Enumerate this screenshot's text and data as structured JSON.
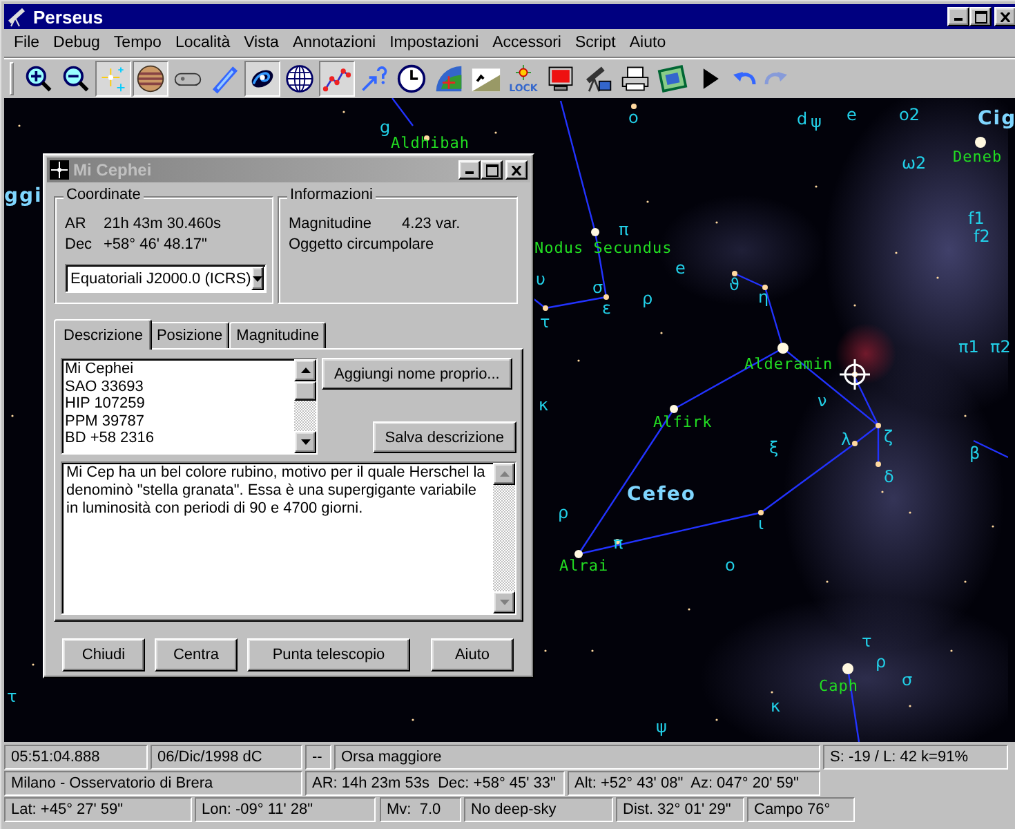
{
  "window": {
    "title": "Perseus"
  },
  "menu": [
    "File",
    "Debug",
    "Tempo",
    "Località",
    "Vista",
    "Annotazioni",
    "Impostazioni",
    "Accessori",
    "Script",
    "Aiuto"
  ],
  "toolbar": [
    {
      "pressed": false,
      "disabled": false
    },
    {
      "pressed": false,
      "disabled": false
    },
    {
      "pressed": true,
      "disabled": false
    },
    {
      "pressed": true,
      "disabled": false
    },
    {
      "pressed": false,
      "disabled": false
    },
    {
      "pressed": false,
      "disabled": false
    },
    {
      "pressed": true,
      "disabled": false
    },
    {
      "pressed": false,
      "disabled": false
    },
    {
      "pressed": true,
      "disabled": false
    },
    {
      "pressed": false,
      "disabled": false
    },
    {
      "pressed": false,
      "disabled": false
    },
    {
      "pressed": false,
      "disabled": false
    },
    {
      "pressed": false,
      "disabled": false
    },
    {
      "pressed": false,
      "disabled": false,
      "label": "LOCK"
    },
    {
      "pressed": false,
      "disabled": false
    },
    {
      "pressed": false,
      "disabled": false
    },
    {
      "pressed": false,
      "disabled": false
    },
    {
      "pressed": false,
      "disabled": false
    },
    {
      "pressed": false,
      "disabled": false
    },
    {
      "pressed": false,
      "disabled": false
    },
    {
      "pressed": false,
      "disabled": true
    }
  ],
  "sky_map": {
    "labels": [
      {
        "text": "g",
        "kind": "letter"
      },
      {
        "text": "Aldhibah",
        "kind": "star"
      },
      {
        "text": "ggi",
        "kind": "constellation"
      },
      {
        "text": "ο",
        "kind": "letter"
      },
      {
        "text": "d",
        "kind": "letter"
      },
      {
        "text": "ψ",
        "kind": "letter"
      },
      {
        "text": "e",
        "kind": "letter"
      },
      {
        "text": "ο2",
        "kind": "letter"
      },
      {
        "text": "Cig",
        "kind": "constellation"
      },
      {
        "text": "ω2",
        "kind": "letter"
      },
      {
        "text": "Deneb",
        "kind": "star"
      },
      {
        "text": "f1",
        "kind": "letter"
      },
      {
        "text": "f2",
        "kind": "letter"
      },
      {
        "text": "π",
        "kind": "letter"
      },
      {
        "text": "Nodus Secundus",
        "kind": "star"
      },
      {
        "text": "e",
        "kind": "letter"
      },
      {
        "text": "υ",
        "kind": "letter"
      },
      {
        "text": "σ",
        "kind": "letter"
      },
      {
        "text": "ρ",
        "kind": "letter"
      },
      {
        "text": "ε",
        "kind": "letter"
      },
      {
        "text": "τ",
        "kind": "letter"
      },
      {
        "text": "ϑ",
        "kind": "letter"
      },
      {
        "text": "η",
        "kind": "letter"
      },
      {
        "text": "Alderamin",
        "kind": "star"
      },
      {
        "text": "ν",
        "kind": "letter"
      },
      {
        "text": "π1",
        "kind": "letter"
      },
      {
        "text": "π2",
        "kind": "letter"
      },
      {
        "text": "κ",
        "kind": "letter"
      },
      {
        "text": "Alfirk",
        "kind": "star"
      },
      {
        "text": "ξ",
        "kind": "letter"
      },
      {
        "text": "λ",
        "kind": "letter"
      },
      {
        "text": "ζ",
        "kind": "letter"
      },
      {
        "text": "δ",
        "kind": "letter"
      },
      {
        "text": "β",
        "kind": "letter"
      },
      {
        "text": "Cefeo",
        "kind": "constellation"
      },
      {
        "text": "ρ",
        "kind": "letter"
      },
      {
        "text": "ι",
        "kind": "letter"
      },
      {
        "text": "π",
        "kind": "letter"
      },
      {
        "text": "Alrai",
        "kind": "star"
      },
      {
        "text": "ο",
        "kind": "letter"
      },
      {
        "text": "τ",
        "kind": "letter"
      },
      {
        "text": "ρ",
        "kind": "letter"
      },
      {
        "text": "σ",
        "kind": "letter"
      },
      {
        "text": "Caph",
        "kind": "star"
      },
      {
        "text": "κ",
        "kind": "letter"
      },
      {
        "text": "ψ",
        "kind": "letter"
      },
      {
        "text": "τ",
        "kind": "letter"
      }
    ]
  },
  "dialog": {
    "title": "Mi Cephei",
    "coordinates": {
      "title": "Coordinate",
      "rows": [
        {
          "label": "AR",
          "value": "21h 43m 30.460s"
        },
        {
          "label": "Dec",
          "value": "+58° 46' 48.17\""
        }
      ],
      "system": "Equatoriali J2000.0 (ICRS)"
    },
    "information": {
      "title": "Informazioni",
      "rows": [
        {
          "label": "Magnitudine",
          "value": "4.23 var."
        }
      ],
      "note": "Oggetto circumpolare"
    },
    "tabs": [
      {
        "label": "Descrizione",
        "selected": true
      },
      {
        "label": "Posizione",
        "selected": false
      },
      {
        "label": "Magnitudine",
        "selected": false
      }
    ],
    "names": [
      "Mi Cephei",
      "SAO 33693",
      "HIP 107259",
      "PPM 39787",
      "BD +58 2316"
    ],
    "side_buttons": [
      "Aggiungi nome proprio...",
      "Salva descrizione"
    ],
    "description": "Mi Cep ha un bel colore rubino, motivo per il quale Herschel la denominò \"stella granata\". Essa è una supergigante variabile in luminosità con periodi di 90 e 4700 giorni.",
    "buttons": [
      "Chiudi",
      "Centra",
      "Punta telescopio",
      "Aiuto"
    ]
  },
  "status_bar": {
    "lines": [
      {
        "panels": [
          "05:51:04.888",
          "06/Dic/1998 dC",
          "--",
          "Orsa maggiore",
          "S: -19 / L: 42 k=91%"
        ]
      },
      {
        "panels": [
          "Milano - Osservatorio di Brera",
          "AR: 14h 23m 53s  Dec: +58° 45' 33\"",
          "Alt: +52° 43' 08\"  Az: 047° 20' 59\""
        ]
      },
      {
        "panels": [
          "Lat: +45° 27' 59\"",
          "Lon: -09° 11' 28\"",
          "Mv:  7.0",
          "No deep-sky",
          "Dist. 32° 01' 29\"",
          "Campo 76°"
        ]
      }
    ]
  }
}
